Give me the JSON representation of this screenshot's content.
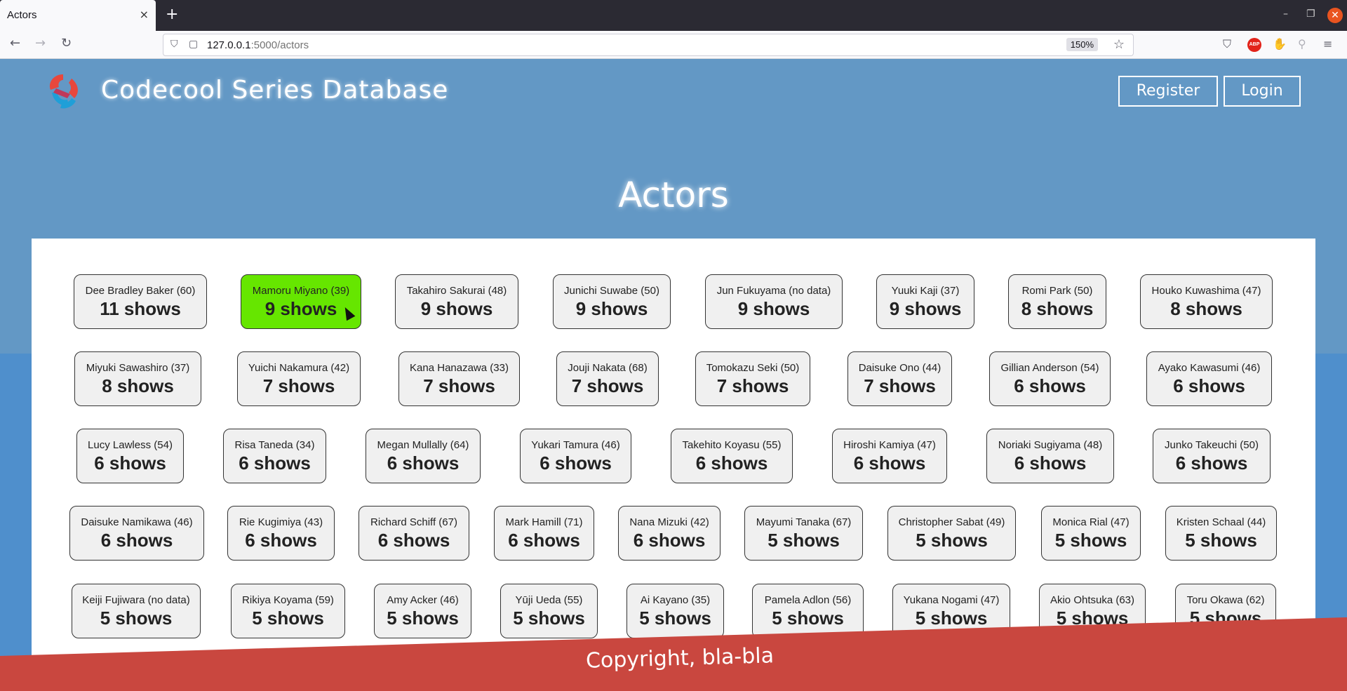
{
  "browser": {
    "tab_title": "Actors",
    "tab_close": "×",
    "new_tab": "+",
    "url_host": "127.0.0.1",
    "url_path": ":5000/actors",
    "zoom": "150%"
  },
  "site": {
    "title": "Codecool Series Database",
    "register_label": "Register",
    "login_label": "Login"
  },
  "page": {
    "heading": "Actors"
  },
  "actors": [
    {
      "name": "Dee Bradley Baker (60)",
      "shows": "11 shows"
    },
    {
      "name": "Mamoru Miyano (39)",
      "shows": "9 shows"
    },
    {
      "name": "Takahiro Sakurai (48)",
      "shows": "9 shows"
    },
    {
      "name": "Junichi Suwabe (50)",
      "shows": "9 shows"
    },
    {
      "name": "Jun Fukuyama (no data)",
      "shows": "9 shows"
    },
    {
      "name": "Yuuki Kaji (37)",
      "shows": "9 shows"
    },
    {
      "name": "Romi Park (50)",
      "shows": "8 shows"
    },
    {
      "name": "Houko Kuwashima (47)",
      "shows": "8 shows"
    },
    {
      "name": "Miyuki Sawashiro (37)",
      "shows": "8 shows"
    },
    {
      "name": "Yuichi Nakamura (42)",
      "shows": "7 shows"
    },
    {
      "name": "Kana Hanazawa (33)",
      "shows": "7 shows"
    },
    {
      "name": "Jouji Nakata (68)",
      "shows": "7 shows"
    },
    {
      "name": "Tomokazu Seki (50)",
      "shows": "7 shows"
    },
    {
      "name": "Daisuke Ono (44)",
      "shows": "7 shows"
    },
    {
      "name": "Gillian Anderson (54)",
      "shows": "6 shows"
    },
    {
      "name": "Ayako Kawasumi (46)",
      "shows": "6 shows"
    },
    {
      "name": "Lucy Lawless (54)",
      "shows": "6 shows"
    },
    {
      "name": "Risa Taneda (34)",
      "shows": "6 shows"
    },
    {
      "name": "Megan Mullally (64)",
      "shows": "6 shows"
    },
    {
      "name": "Yukari Tamura (46)",
      "shows": "6 shows"
    },
    {
      "name": "Takehito Koyasu (55)",
      "shows": "6 shows"
    },
    {
      "name": "Hiroshi Kamiya (47)",
      "shows": "6 shows"
    },
    {
      "name": "Noriaki Sugiyama (48)",
      "shows": "6 shows"
    },
    {
      "name": "Junko Takeuchi (50)",
      "shows": "6 shows"
    },
    {
      "name": "Daisuke Namikawa (46)",
      "shows": "6 shows"
    },
    {
      "name": "Rie Kugimiya (43)",
      "shows": "6 shows"
    },
    {
      "name": "Richard Schiff (67)",
      "shows": "6 shows"
    },
    {
      "name": "Mark Hamill (71)",
      "shows": "6 shows"
    },
    {
      "name": "Nana Mizuki (42)",
      "shows": "6 shows"
    },
    {
      "name": "Mayumi Tanaka (67)",
      "shows": "5 shows"
    },
    {
      "name": "Christopher Sabat (49)",
      "shows": "5 shows"
    },
    {
      "name": "Monica Rial (47)",
      "shows": "5 shows"
    },
    {
      "name": "Kristen Schaal (44)",
      "shows": "5 shows"
    },
    {
      "name": "Keiji Fujiwara (no data)",
      "shows": "5 shows"
    },
    {
      "name": "Rikiya Koyama (59)",
      "shows": "5 shows"
    },
    {
      "name": "Amy Acker (46)",
      "shows": "5 shows"
    },
    {
      "name": "Yūji Ueda (55)",
      "shows": "5 shows"
    },
    {
      "name": "Ai Kayano (35)",
      "shows": "5 shows"
    },
    {
      "name": "Pamela Adlon (56)",
      "shows": "5 shows"
    },
    {
      "name": "Yukana Nogami (47)",
      "shows": "5 shows"
    },
    {
      "name": "Akio Ohtsuka (63)",
      "shows": "5 shows"
    },
    {
      "name": "Toru Okawa (62)",
      "shows": "5 shows"
    }
  ],
  "footer": {
    "text": "Copyright, bla-bla"
  },
  "colors": {
    "page_bg": "#6398c5",
    "active_card": "#66e600",
    "footer": "#c9473f"
  }
}
